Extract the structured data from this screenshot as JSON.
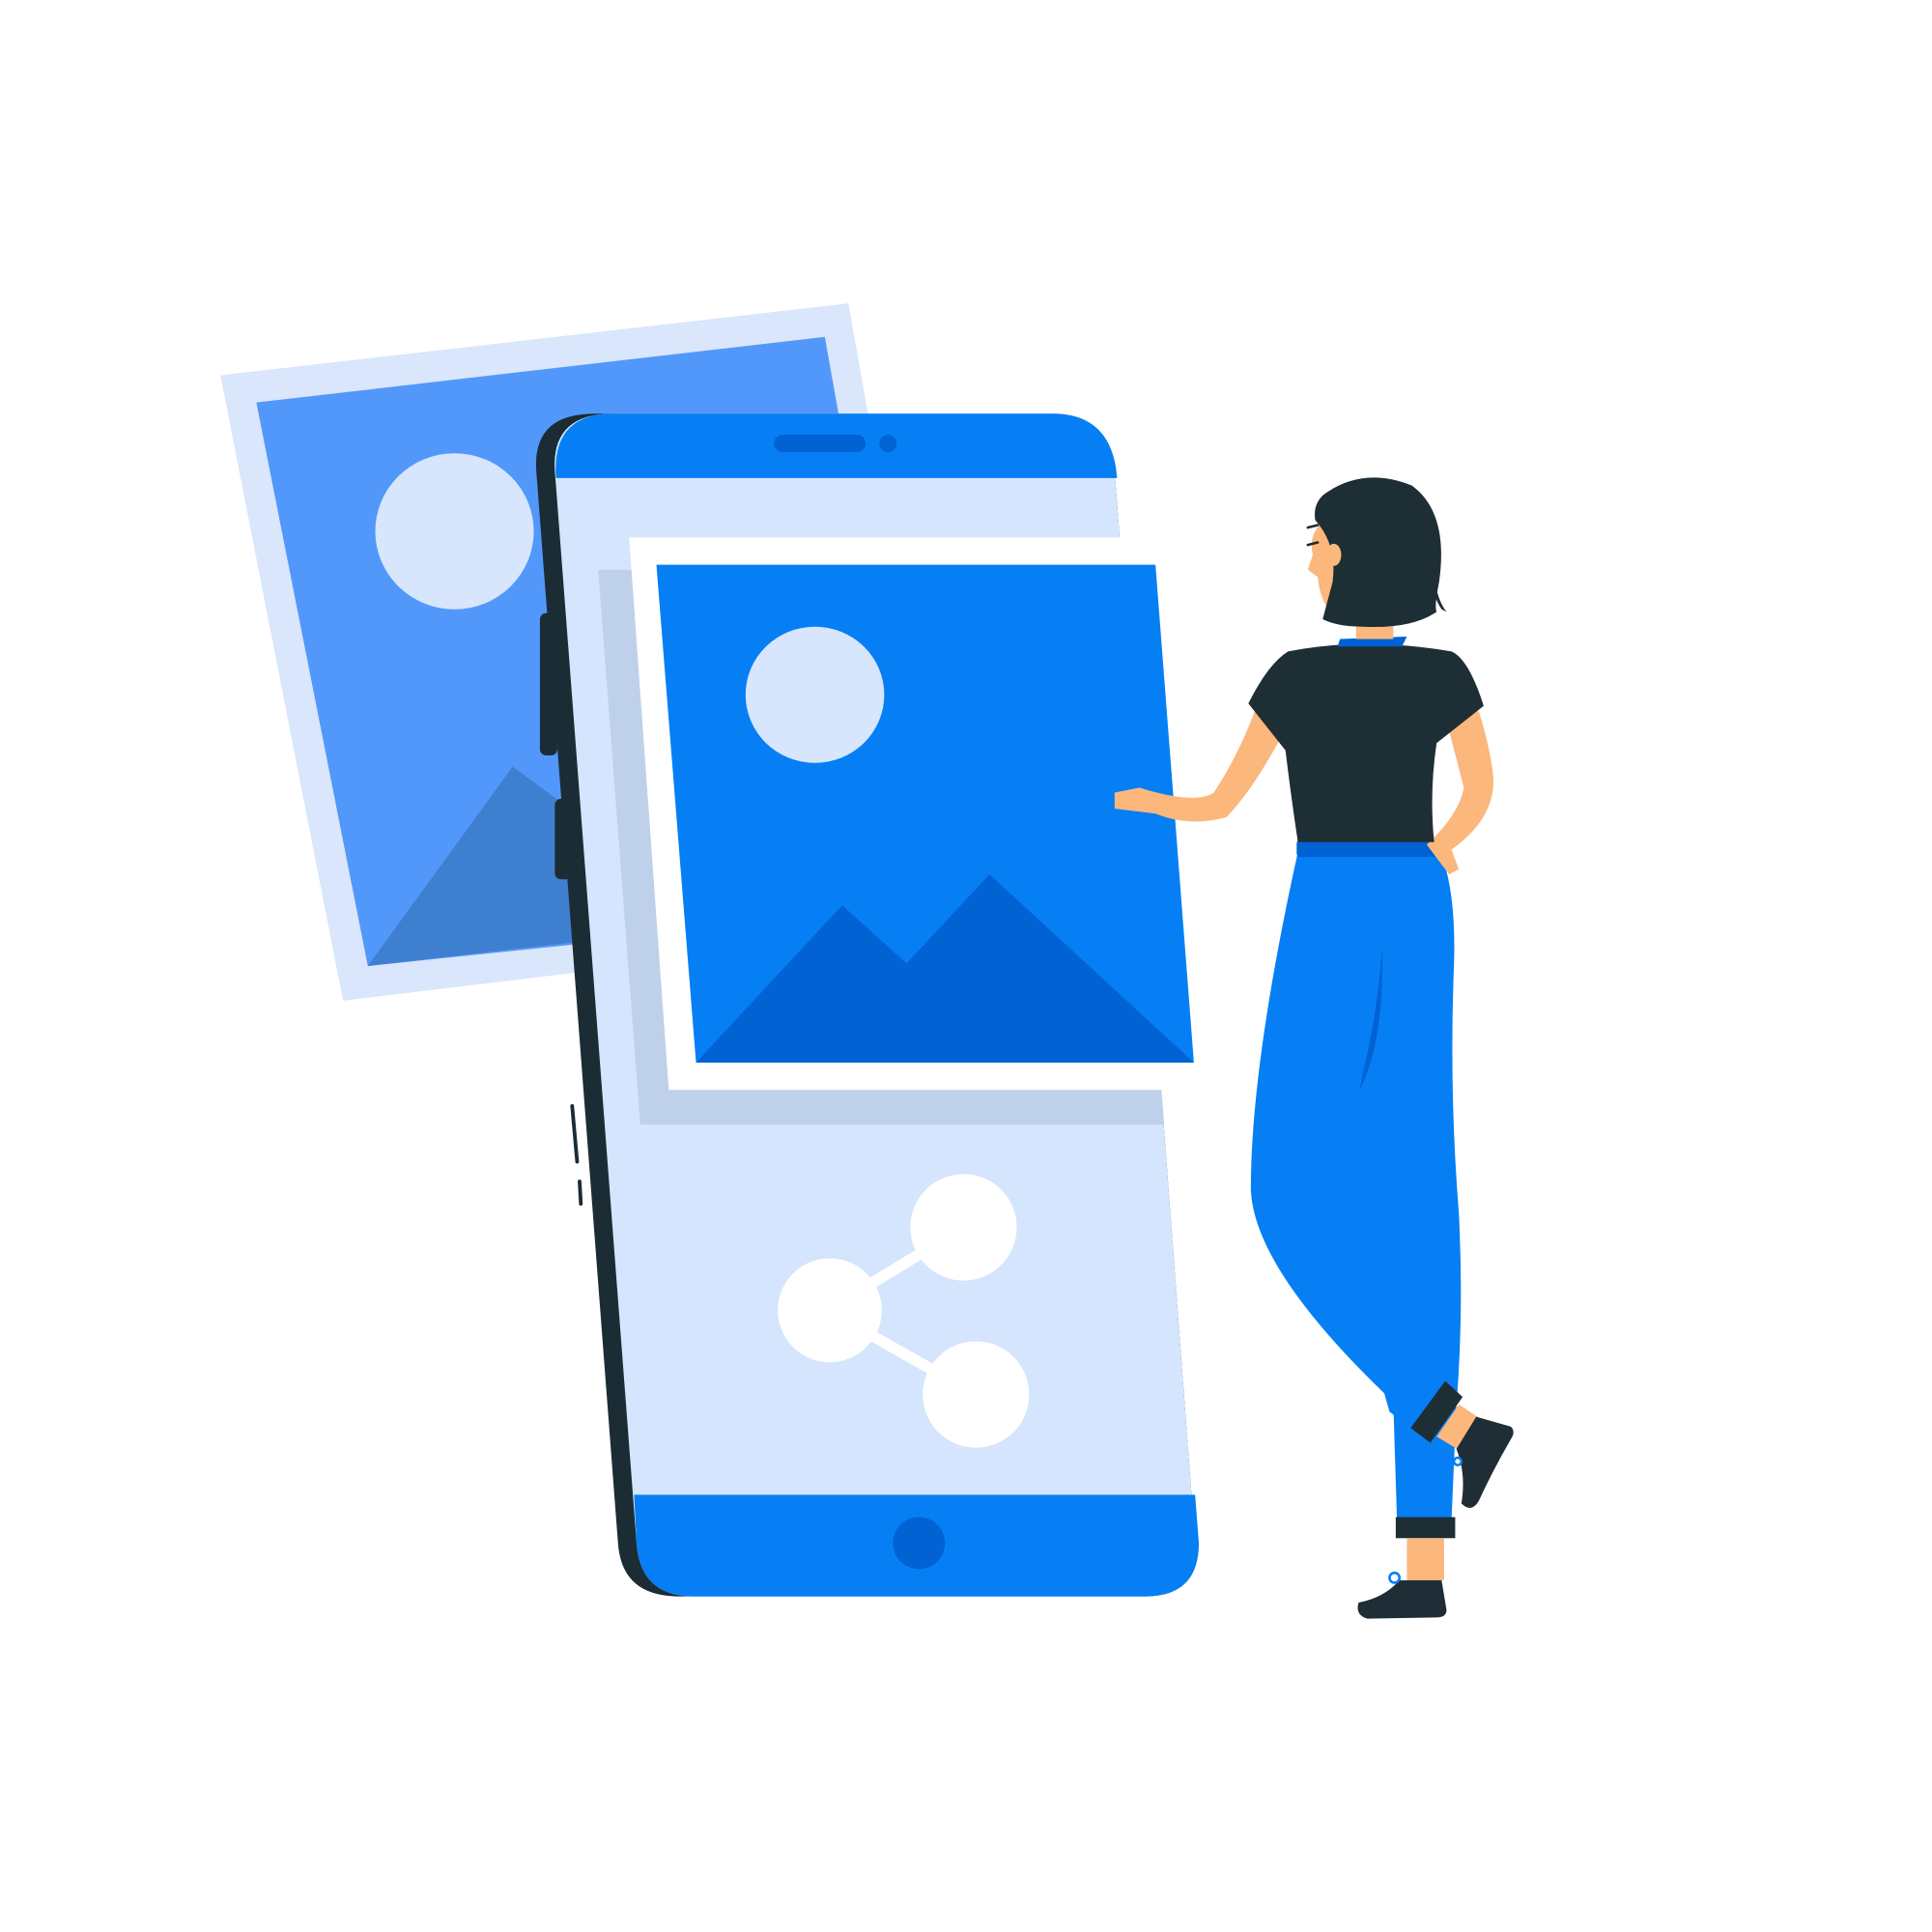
{
  "scene": {
    "background_color": "#ffffff"
  },
  "palette": {
    "primary_blue": "#067ff5",
    "back_photo_blue": "#5298fa",
    "light_blue": "#d4e5fd",
    "pale_frame": "#d9e6fb",
    "screen_shadow": "#bfd0ea",
    "mountain_dark": "#0062d3",
    "back_mountain": "#3f7fd0",
    "sun_light": "#d7e6fc",
    "share_white": "#ffffff",
    "phone_outline": "#1c2c35",
    "hair_shirt": "#1e2e35",
    "skin": "#fbb77c",
    "jeans": "#067ff5",
    "shoe": "#1f2d36"
  },
  "illustration": {
    "theme": "Share photos",
    "icons": {
      "back_photo": "image-icon",
      "front_photo": "image-icon",
      "share": "share-icon",
      "phone": "smartphone-icon",
      "person": "person-illustration"
    }
  }
}
